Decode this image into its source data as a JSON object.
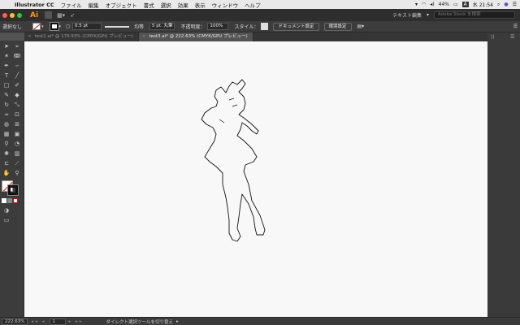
{
  "menubar": {
    "apple": "",
    "items": [
      "Illustrator CC",
      "ファイル",
      "編集",
      "オブジェクト",
      "書式",
      "選択",
      "効果",
      "表示",
      "ウィンドウ",
      "ヘルプ"
    ],
    "battery": "44%",
    "clock": "水 21:54",
    "status_letter": "A"
  },
  "appbar": {
    "logo": "Ai",
    "workspace": "テキスト編集",
    "stock_placeholder": "Adobe Stock を検索"
  },
  "control": {
    "selection_label": "選択なし",
    "stroke_weight": "0.5 pt",
    "profile_label": "均等",
    "brush_label": "5 pt. 丸筆",
    "opacity_label": "不透明度：",
    "opacity_value": "100%",
    "style_label": "スタイル：",
    "doc_setup": "ドキュメント設定",
    "preferences": "環境設定"
  },
  "tabs": [
    {
      "label": "test2.ai* @ 176.93% (CMYK/GPU プレビュー)",
      "active": false
    },
    {
      "label": "test3.ai* @ 222.63% (CMYK/GPU プレビュー)",
      "active": true
    }
  ],
  "statusbar": {
    "zoom": "222.63%",
    "page": "1",
    "status": "ダイレクト選択ツールを切り替え"
  },
  "colors": {
    "accent": "#ff9a00",
    "close": "#ff5f57",
    "minimize": "#febc2e",
    "zoom": "#28c840",
    "artboard_guide": "#bb3333"
  },
  "icons": {
    "tools": [
      "selection-tool-icon",
      "direct-selection-tool-icon",
      "magic-wand-icon",
      "lasso-icon",
      "pen-tool-icon",
      "curvature-icon",
      "type-tool-icon",
      "line-tool-icon",
      "rectangle-tool-icon",
      "paintbrush-icon",
      "pencil-icon",
      "eraser-icon",
      "rotate-icon",
      "scale-icon",
      "warp-icon",
      "free-transform-icon",
      "shape-builder-icon",
      "perspective-icon",
      "mesh-icon",
      "gradient-icon",
      "eyedropper-icon",
      "blend-icon",
      "symbol-sprayer-icon",
      "graph-icon",
      "artboard-icon",
      "slice-icon",
      "hand-icon",
      "zoom-icon"
    ]
  }
}
